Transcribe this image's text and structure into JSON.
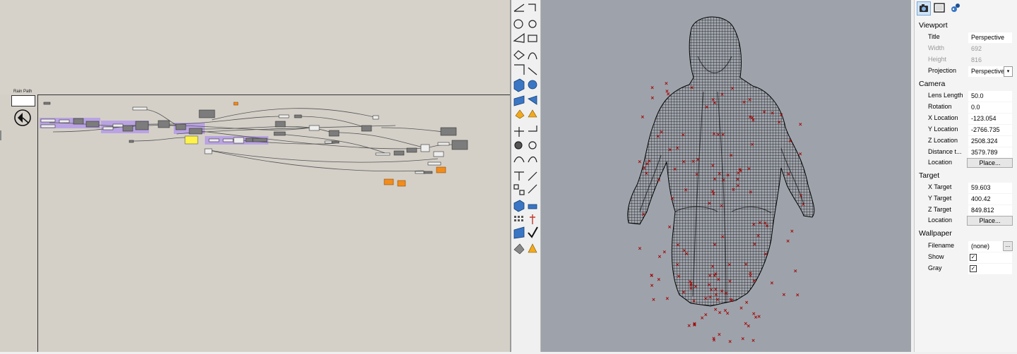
{
  "grasshopper": {
    "rain_path_label": "Rain Path"
  },
  "properties": {
    "tabs": [
      {
        "name": "camera-icon",
        "active": true
      },
      {
        "name": "frame-icon",
        "active": false
      },
      {
        "name": "wallpaper-icon",
        "active": false
      }
    ],
    "viewport": {
      "heading": "Viewport",
      "title_label": "Title",
      "title_value": "Perspective",
      "width_label": "Width",
      "width_value": "692",
      "height_label": "Height",
      "height_value": "816",
      "projection_label": "Projection",
      "projection_value": "Perspective"
    },
    "camera": {
      "heading": "Camera",
      "lens_label": "Lens Length",
      "lens_value": "50.0",
      "rotation_label": "Rotation",
      "rotation_value": "0.0",
      "x_label": "X Location",
      "x_value": "-123.054",
      "y_label": "Y Location",
      "y_value": "-2766.735",
      "z_label": "Z Location",
      "z_value": "2508.324",
      "distance_label": "Distance t...",
      "distance_value": "3579.789",
      "location_label": "Location",
      "location_button": "Place..."
    },
    "target": {
      "heading": "Target",
      "x_label": "X Target",
      "x_value": "59.603",
      "y_label": "Y Target",
      "y_value": "400.42",
      "z_label": "Z Target",
      "z_value": "849.812",
      "location_label": "Location",
      "location_button": "Place..."
    },
    "wallpaper": {
      "heading": "Wallpaper",
      "filename_label": "Filename",
      "filename_value": "(none)",
      "browse_button": "...",
      "show_label": "Show",
      "show_checked": true,
      "gray_label": "Gray",
      "gray_checked": true
    }
  },
  "colors": {
    "canvas": "#d4d0c8",
    "viewport": "#9ea3ab",
    "group": "#b59be8",
    "mesh": "#111111",
    "rain_points": "#a40000",
    "orange_panel": "#f28c1a",
    "yellow_panel": "#fff34a"
  }
}
